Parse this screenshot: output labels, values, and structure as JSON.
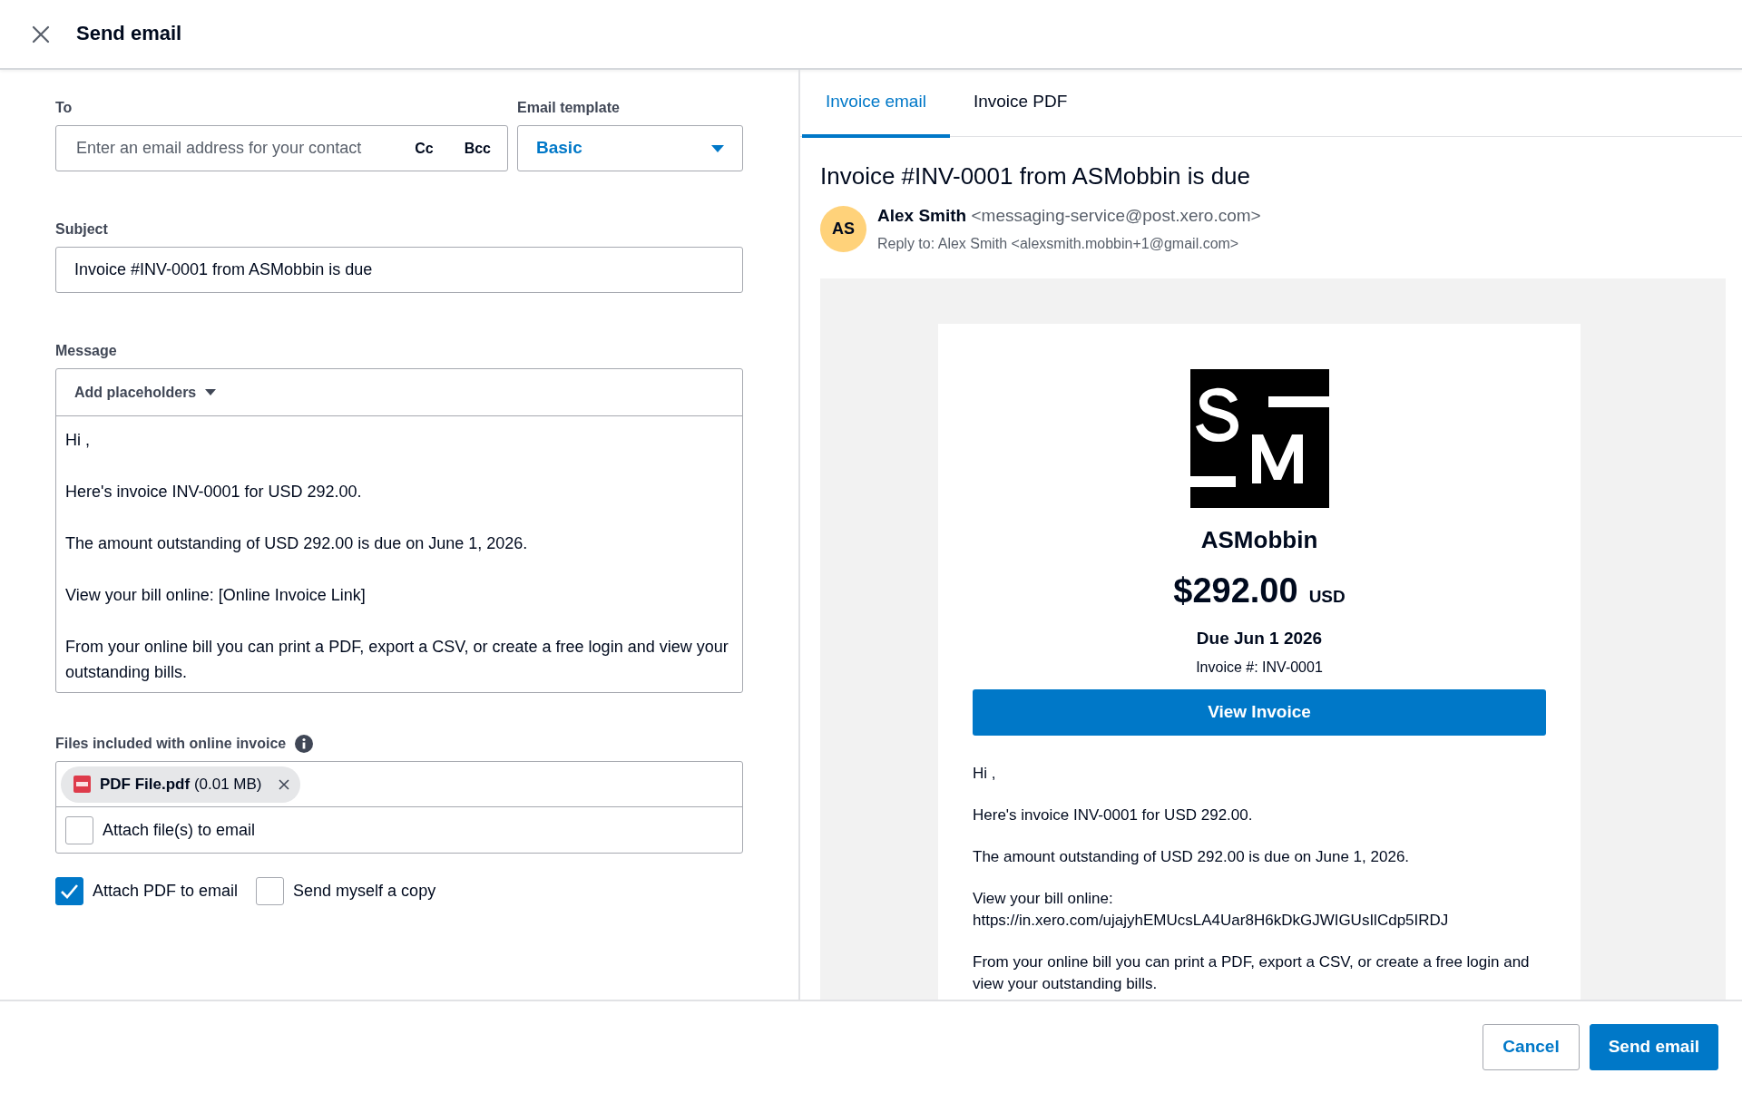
{
  "window": {
    "title": "Send email"
  },
  "form": {
    "to": {
      "label": "To",
      "placeholder": "Enter an email address for your contact",
      "links": [
        "Cc",
        "Bcc"
      ]
    },
    "template": {
      "label": "Email template",
      "value": "Basic"
    },
    "subject": {
      "label": "Subject",
      "value": "Invoice #INV-0001 from ASMobbin is due"
    },
    "message": {
      "label": "Message",
      "placeholders_button": "Add placeholders",
      "paragraphs": [
        "Hi ,",
        "Here's invoice INV-0001 for USD 292.00.",
        "The amount outstanding of USD 292.00 is due on June 1, 2026.",
        "View your bill online: [Online Invoice Link]",
        "From your online bill you can print a PDF, export a CSV, or create a free login and view your outstanding bills."
      ]
    },
    "files": {
      "label": "Files included with online invoice",
      "items": [
        {
          "name": "PDF File.pdf",
          "size": "(0.01 MB)"
        }
      ],
      "attach": {
        "label": "Attach file(s) to email",
        "checked": false
      }
    },
    "options": [
      {
        "label": "Attach PDF to email",
        "checked": true
      },
      {
        "label": "Send myself a copy",
        "checked": false
      }
    ]
  },
  "preview": {
    "tabs": [
      {
        "label": "Invoice email",
        "selected": true
      },
      {
        "label": "Invoice PDF",
        "selected": false
      }
    ],
    "subject": "Invoice #INV-0001 from ASMobbin is due",
    "sender": {
      "initials": "AS",
      "name": "Alex Smith",
      "address": "<messaging-service@post.xero.com>",
      "reply_to": "Reply to: Alex Smith <alexsmith.mobbin+1@gmail.com>"
    },
    "email": {
      "company": "ASMobbin",
      "amount": "$292.00",
      "currency": "USD",
      "due": "Due Jun 1 2026",
      "invoice_number": "Invoice #: INV-0001",
      "button": "View Invoice",
      "paragraphs": [
        [
          "Hi ,"
        ],
        [
          "Here's invoice INV-0001 for USD 292.00."
        ],
        [
          "The amount outstanding of USD 292.00 is due on June 1, 2026."
        ],
        [
          "View your bill online:",
          "https://in.xero.com/ujajyhEMUcsLA4Uar8H6kDkGJWIGUsIlCdp5IRDJ"
        ],
        [
          "From your online bill you can print a PDF, export a CSV, or create a free login and view your outstanding bills."
        ]
      ]
    }
  },
  "footer": {
    "buttons": [
      {
        "label": "Cancel",
        "kind": "secondary"
      },
      {
        "label": "Send email",
        "kind": "primary"
      }
    ]
  }
}
